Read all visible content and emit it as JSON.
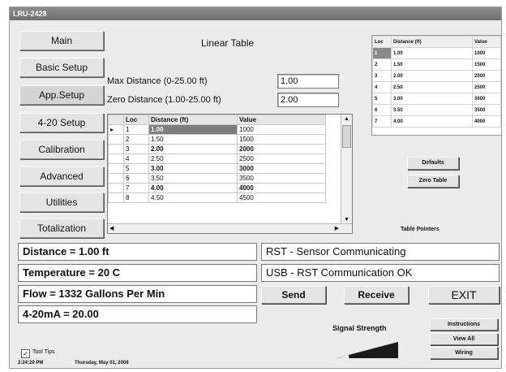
{
  "window": {
    "title": "LRU-2428"
  },
  "nav": [
    "Main",
    "Basic Setup",
    "App.Setup",
    "4-20 Setup",
    "Calibration",
    "Advanced",
    "Utilities",
    "Totalization"
  ],
  "linear": {
    "heading": "Linear Table",
    "max_label": "Max Distance (0-25.00 ft)",
    "max_value": "1.00",
    "zero_label": "Zero Distance (1.00-25.00 ft)",
    "zero_value": "2.00"
  },
  "grid": {
    "headers": [
      "Loc",
      "Distance (ft)",
      "Value"
    ],
    "rows": [
      [
        "1",
        "1.00",
        "1000"
      ],
      [
        "2",
        "1.50",
        "1500"
      ],
      [
        "3",
        "2.00",
        "2000"
      ],
      [
        "4",
        "2.50",
        "2500"
      ],
      [
        "5",
        "3.00",
        "3000"
      ],
      [
        "6",
        "3.50",
        "3500"
      ],
      [
        "7",
        "4.00",
        "4000"
      ],
      [
        "8",
        "4.50",
        "4500"
      ]
    ]
  },
  "points_table": {
    "headers": [
      "Loc",
      "Distance (ft)",
      "Value"
    ],
    "rows": [
      [
        "1",
        "1.00",
        "1000"
      ],
      [
        "2",
        "1.50",
        "1500"
      ],
      [
        "3",
        "2.00",
        "2000"
      ],
      [
        "4",
        "2.50",
        "2500"
      ],
      [
        "5",
        "3.00",
        "3000"
      ],
      [
        "6",
        "3.50",
        "3500"
      ],
      [
        "7",
        "4.00",
        "4000"
      ]
    ],
    "caption": "Table Pointers"
  },
  "buttons": {
    "defaults": "Defaults",
    "zero_table": "Zero Table",
    "send": "Send",
    "receive": "Receive",
    "exit": "EXIT",
    "instructions": "Instructions",
    "view_all": "View All",
    "wiring": "Wiring"
  },
  "status": {
    "distance": "Distance = 1.00 ft",
    "temperature": "Temperature = 20 C",
    "flow": "Flow = 1332 Gallons  Per Min",
    "ma": "4-20mA = 20.00",
    "rst": "RST - Sensor Communicating",
    "usb": "USB - RST Communication OK"
  },
  "signal": {
    "label": "Signal Strength",
    "level": 0.8
  },
  "tooltips": {
    "label": "Tool Tips",
    "checked": true
  },
  "footer": {
    "time": "2:24:29 PM",
    "date": "Thursday, May 01, 2008"
  }
}
